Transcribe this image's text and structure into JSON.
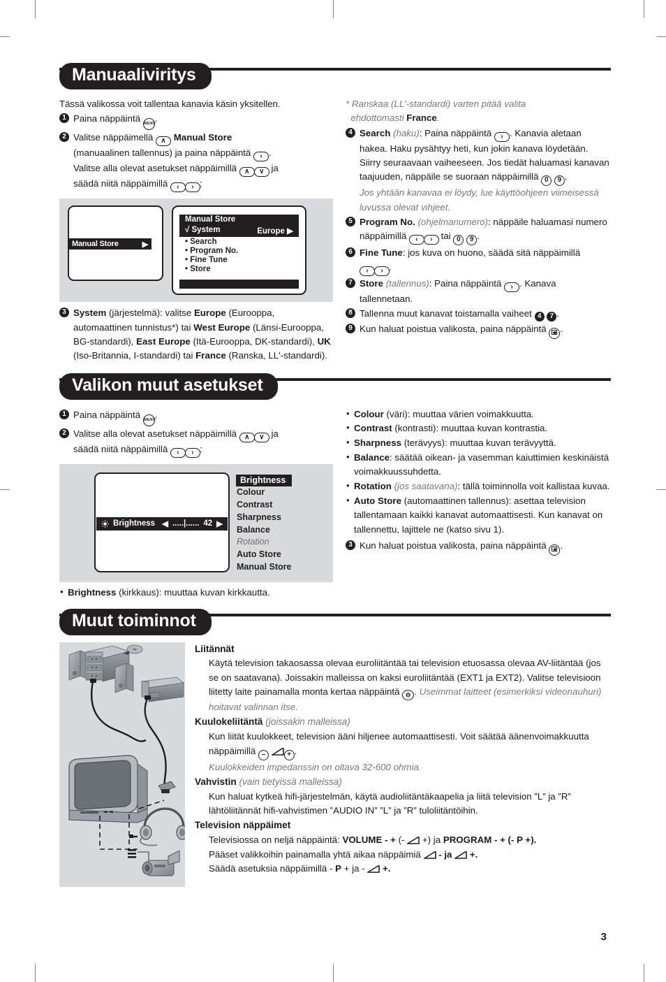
{
  "page": {
    "number": "3"
  },
  "sections": [
    {
      "id": "manual-tuning",
      "title": "Manuaaliviritys",
      "intro": "Tässä valikossa voit tallentaa kanavia käsin yksitellen.",
      "steps": [
        {
          "num": "1",
          "text_a": "Paina näppäintä ",
          "key": "MENU",
          "text_b": "."
        },
        {
          "num": "2",
          "line1_a": "Valitse näppäimellä ",
          "line1_b": "Manual Store",
          "line2": "(manuaalinen tallennus) ja paina näppäintä ",
          "line3": "Valitse alla olevat asetukset näppäimillä ",
          "line3_end": " ja",
          "line4": "säädä niitä näppäimillä "
        },
        {
          "num": "3",
          "text": "System (järjestelmä): valitse Europe (Eurooppa, automaattinen tunnistus*) tai West Europe (Länsi-Eurooppa, BG-standardi), East Europe (Itä-Eurooppa, DK-standardi), UK (Iso-Britannia, I-standardi) tai France (Ranska, LL'-standardi).",
          "bold_terms": [
            "System",
            "Europe",
            "West Europe",
            "East Europe",
            "UK",
            "France"
          ]
        }
      ],
      "footnote": "* Ranskaa (LL'-standardi) varten pitää valita ehdottomasti France.",
      "footnote_bold": "France",
      "steps_right": [
        {
          "num": "4",
          "label": "Search",
          "label_it": "(haku)",
          "text": ": Paina näppäintä . Kanavia aletaan hakea. Haku pysähtyy heti, kun jokin kanava löydetään. Siirry seuraavaan vaiheeseen. Jos tiedät haluamasi kanavan taajuuden, näppäile se suoraan näppäimillä ",
          "note": "Jos yhtään kanavaa ei löydy, lue käyttöohjeen viimeisessä luvussa olevat vihjeet."
        },
        {
          "num": "5",
          "label": "Program No.",
          "label_it": "(ohjelmanumero)",
          "text": ": näppäile haluamasi numero näppäimillä  tai ."
        },
        {
          "num": "6",
          "label": "Fine Tune",
          "text": ": jos kuva on huono, säädä sitä näppäimillä ."
        },
        {
          "num": "7",
          "label": "Store",
          "label_it": "(tallennus)",
          "text": ": Paina näppäintä . Kanava tallennetaan."
        },
        {
          "num": "8",
          "text": "Tallenna muut kanavat toistamalla vaiheet",
          "ref1": "4",
          "ref2": "7"
        },
        {
          "num": "9",
          "text": "Kun haluat poistua valikosta, paina näppäintä ."
        }
      ],
      "osd": {
        "left_item": "Manual Store",
        "header": "Manual Store",
        "selected_row": {
          "check": "√",
          "label": "System",
          "value": "Europe",
          "arrow": "▶"
        },
        "rows": [
          "Search",
          "Program No.",
          "Fine Tune",
          "Store"
        ],
        "bullet": "•"
      }
    },
    {
      "id": "other-menu-settings",
      "title": "Valikon muut asetukset",
      "steps": [
        {
          "num": "1",
          "text": "Paina näppäintä ."
        },
        {
          "num": "2",
          "line1": "Valitse alla olevat asetukset näppäimillä ",
          "line1_end": " ja",
          "line2": "säädä niitä näppäimillä "
        }
      ],
      "osd": {
        "slider_label": "Brightness",
        "slider_left_arrow": "◀",
        "slider_track": ".....|......",
        "slider_value": "42",
        "slider_right_arrow": "▶",
        "menu": [
          {
            "label": "Brightness",
            "state": "selected"
          },
          {
            "label": "Colour",
            "state": "normal"
          },
          {
            "label": "Contrast",
            "state": "normal"
          },
          {
            "label": "Sharpness",
            "state": "normal"
          },
          {
            "label": "Balance",
            "state": "normal"
          },
          {
            "label": "Rotation",
            "state": "dim"
          },
          {
            "label": "Auto Store",
            "state": "normal"
          },
          {
            "label": "Manual Store",
            "state": "normal"
          }
        ]
      },
      "brightness_caption": {
        "term": "Brightness",
        "rest": " (kirkkaus): muuttaa kuvan kirkkautta."
      },
      "bullets": [
        {
          "term": "Colour",
          "rest": " (väri): muuttaa värien voimakkuutta."
        },
        {
          "term": "Contrast",
          "rest": " (kontrasti): muuttaa kuvan kontrastia."
        },
        {
          "term": "Sharpness",
          "rest": " (terävyys): muuttaa kuvan terävyyttä."
        },
        {
          "term": "Balance",
          "rest": ": säätää oikean- ja vasemman kaiuttimien keskinäistä voimakkuussuhdetta."
        },
        {
          "term": "Rotation",
          "rest_it": " (jos saatavana)",
          "rest": ": tällä toiminnolla voit kallistaa kuvaa."
        },
        {
          "term": "Auto Store",
          "rest": " (automaattinen tallennus): asettaa television tallentamaan kaikki kanavat automaattisesti. Kun kanavat on tallennettu, lajittele ne (katso sivu 1)."
        }
      ],
      "exit_step": {
        "num": "3",
        "text": "Kun haluat poistua valikosta, paina näppäintä ."
      }
    },
    {
      "id": "other-functions",
      "title": "Muut toiminnot",
      "blocks": [
        {
          "head": "Liitännät",
          "lines": [
            "Käytä television takaosassa olevaa euroliitäntää tai television etuosassa olevaa",
            "AV-liitäntää (jos se on saatavana). Joissakin malleissa on kaksi euroliitäntää",
            "(EXT1 ja EXT2). Valitse televisioon liitetty laite painamalla monta kertaa",
            "näppäintä "
          ],
          "tail_italic": " Useimmat laitteet (esimerkiksi videonauhuri) hoitavat valinnan itse."
        },
        {
          "head": "Kuulokeliitäntä",
          "head_it": " (joissakin malleissa)",
          "lines": [
            "Kun liität kuulokkeet, television ääni hiljenee automaattisesti. Voit säätää",
            "äänenvoimakkuutta näppäimillä "
          ],
          "note_it": "Kuulokkeiden impedanssin on oltava 32-600 ohmia."
        },
        {
          "head": "Vahvistin",
          "head_it": " (vain tietyissä malleissa)",
          "lines": [
            "Kun haluat kytkeä hifi-järjestelmän, käytä audioliitäntäkaapelia ja liitä television",
            "”L” ja ”R” lähtöliitännät hifi-vahvistimen ”AUDIO IN” ”L” ja ”R” tuloliitäntöihin."
          ]
        },
        {
          "head": "Television näppäimet",
          "lines_rich": [
            {
              "a": "Televisiossa on neljä näppäintä: ",
              "b1": "VOLUME - +",
              "c": " (- ",
              "wedge": true,
              "d": " +) ja ",
              "b2": "PROGRAM - +",
              "e": " (- P +)."
            },
            {
              "a": "Pääset valikkoihin painamalla yhtä aikaa näppäimiä ",
              "wedge": true,
              "d": " - ja ",
              "wedge2": true,
              "e": " +."
            },
            {
              "a": "Säädä asetuksia näppäimillä - ",
              "b1": "P",
              "c": " + ja - ",
              "wedge": true,
              "e": " +."
            }
          ]
        }
      ]
    }
  ],
  "icons": {
    "menu_key": "MENU",
    "up_key": "∧",
    "down_key": "∨",
    "left_key": "‹",
    "right_key": "›",
    "zero_key": "0",
    "nine_key": "9",
    "exit_key": "exit-icon",
    "source_key": "source-icon",
    "minus_key": "–",
    "plus_key": "+",
    "volume_wedge": "volume-wedge-icon"
  },
  "colors": {
    "ink": "#231f20",
    "panel_gray": "#d9dadb",
    "muted_text": "#77787b"
  }
}
